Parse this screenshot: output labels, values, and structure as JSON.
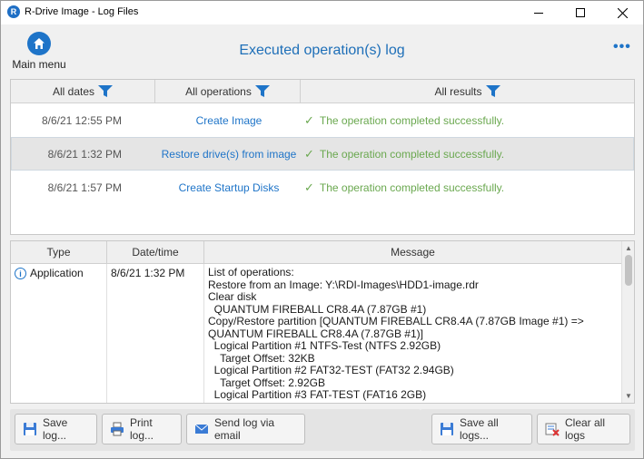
{
  "window": {
    "title": "R-Drive Image - Log Files",
    "app_icon_letter": "R"
  },
  "header": {
    "home_label": "Main menu",
    "title": "Executed operation(s) log",
    "more_glyph": "•••"
  },
  "filters": {
    "dates": "All dates",
    "operations": "All operations",
    "results": "All results"
  },
  "operations": [
    {
      "date": "8/6/21 12:55 PM",
      "name": "Create Image",
      "result": "The operation completed successfully.",
      "selected": false
    },
    {
      "date": "8/6/21 1:32 PM",
      "name": "Restore drive(s) from image",
      "result": "The operation completed successfully.",
      "selected": true
    },
    {
      "date": "8/6/21 1:57 PM",
      "name": "Create Startup Disks",
      "result": "The operation completed successfully.",
      "selected": false
    }
  ],
  "log_table": {
    "headers": {
      "type": "Type",
      "datetime": "Date/time",
      "message": "Message"
    },
    "entry": {
      "type": "Application",
      "datetime": "8/6/21 1:32 PM",
      "message_lines": [
        "List of operations:",
        "Restore from an Image: Y:\\RDI-Images\\HDD1-image.rdr",
        "Clear disk",
        "  QUANTUM FIREBALL CR8.4A (7.87GB #1)",
        "Copy/Restore partition [QUANTUM FIREBALL CR8.4A (7.87GB Image #1) =>",
        "QUANTUM FIREBALL CR8.4A (7.87GB #1)]",
        "  Logical Partition #1 NTFS-Test (NTFS 2.92GB)",
        "    Target Offset: 32KB",
        "  Logical Partition #2 FAT32-TEST (FAT32 2.94GB)",
        "    Target Offset: 2.92GB",
        "  Logical Partition #3 FAT-TEST (FAT16 2GB)"
      ]
    }
  },
  "buttons": {
    "save_log": "Save log...",
    "print_log": "Print log...",
    "send_email": "Send log via email",
    "save_all": "Save all logs...",
    "clear_all": "Clear all logs"
  },
  "colors": {
    "accent": "#1e74c8",
    "success": "#6aa84f"
  }
}
